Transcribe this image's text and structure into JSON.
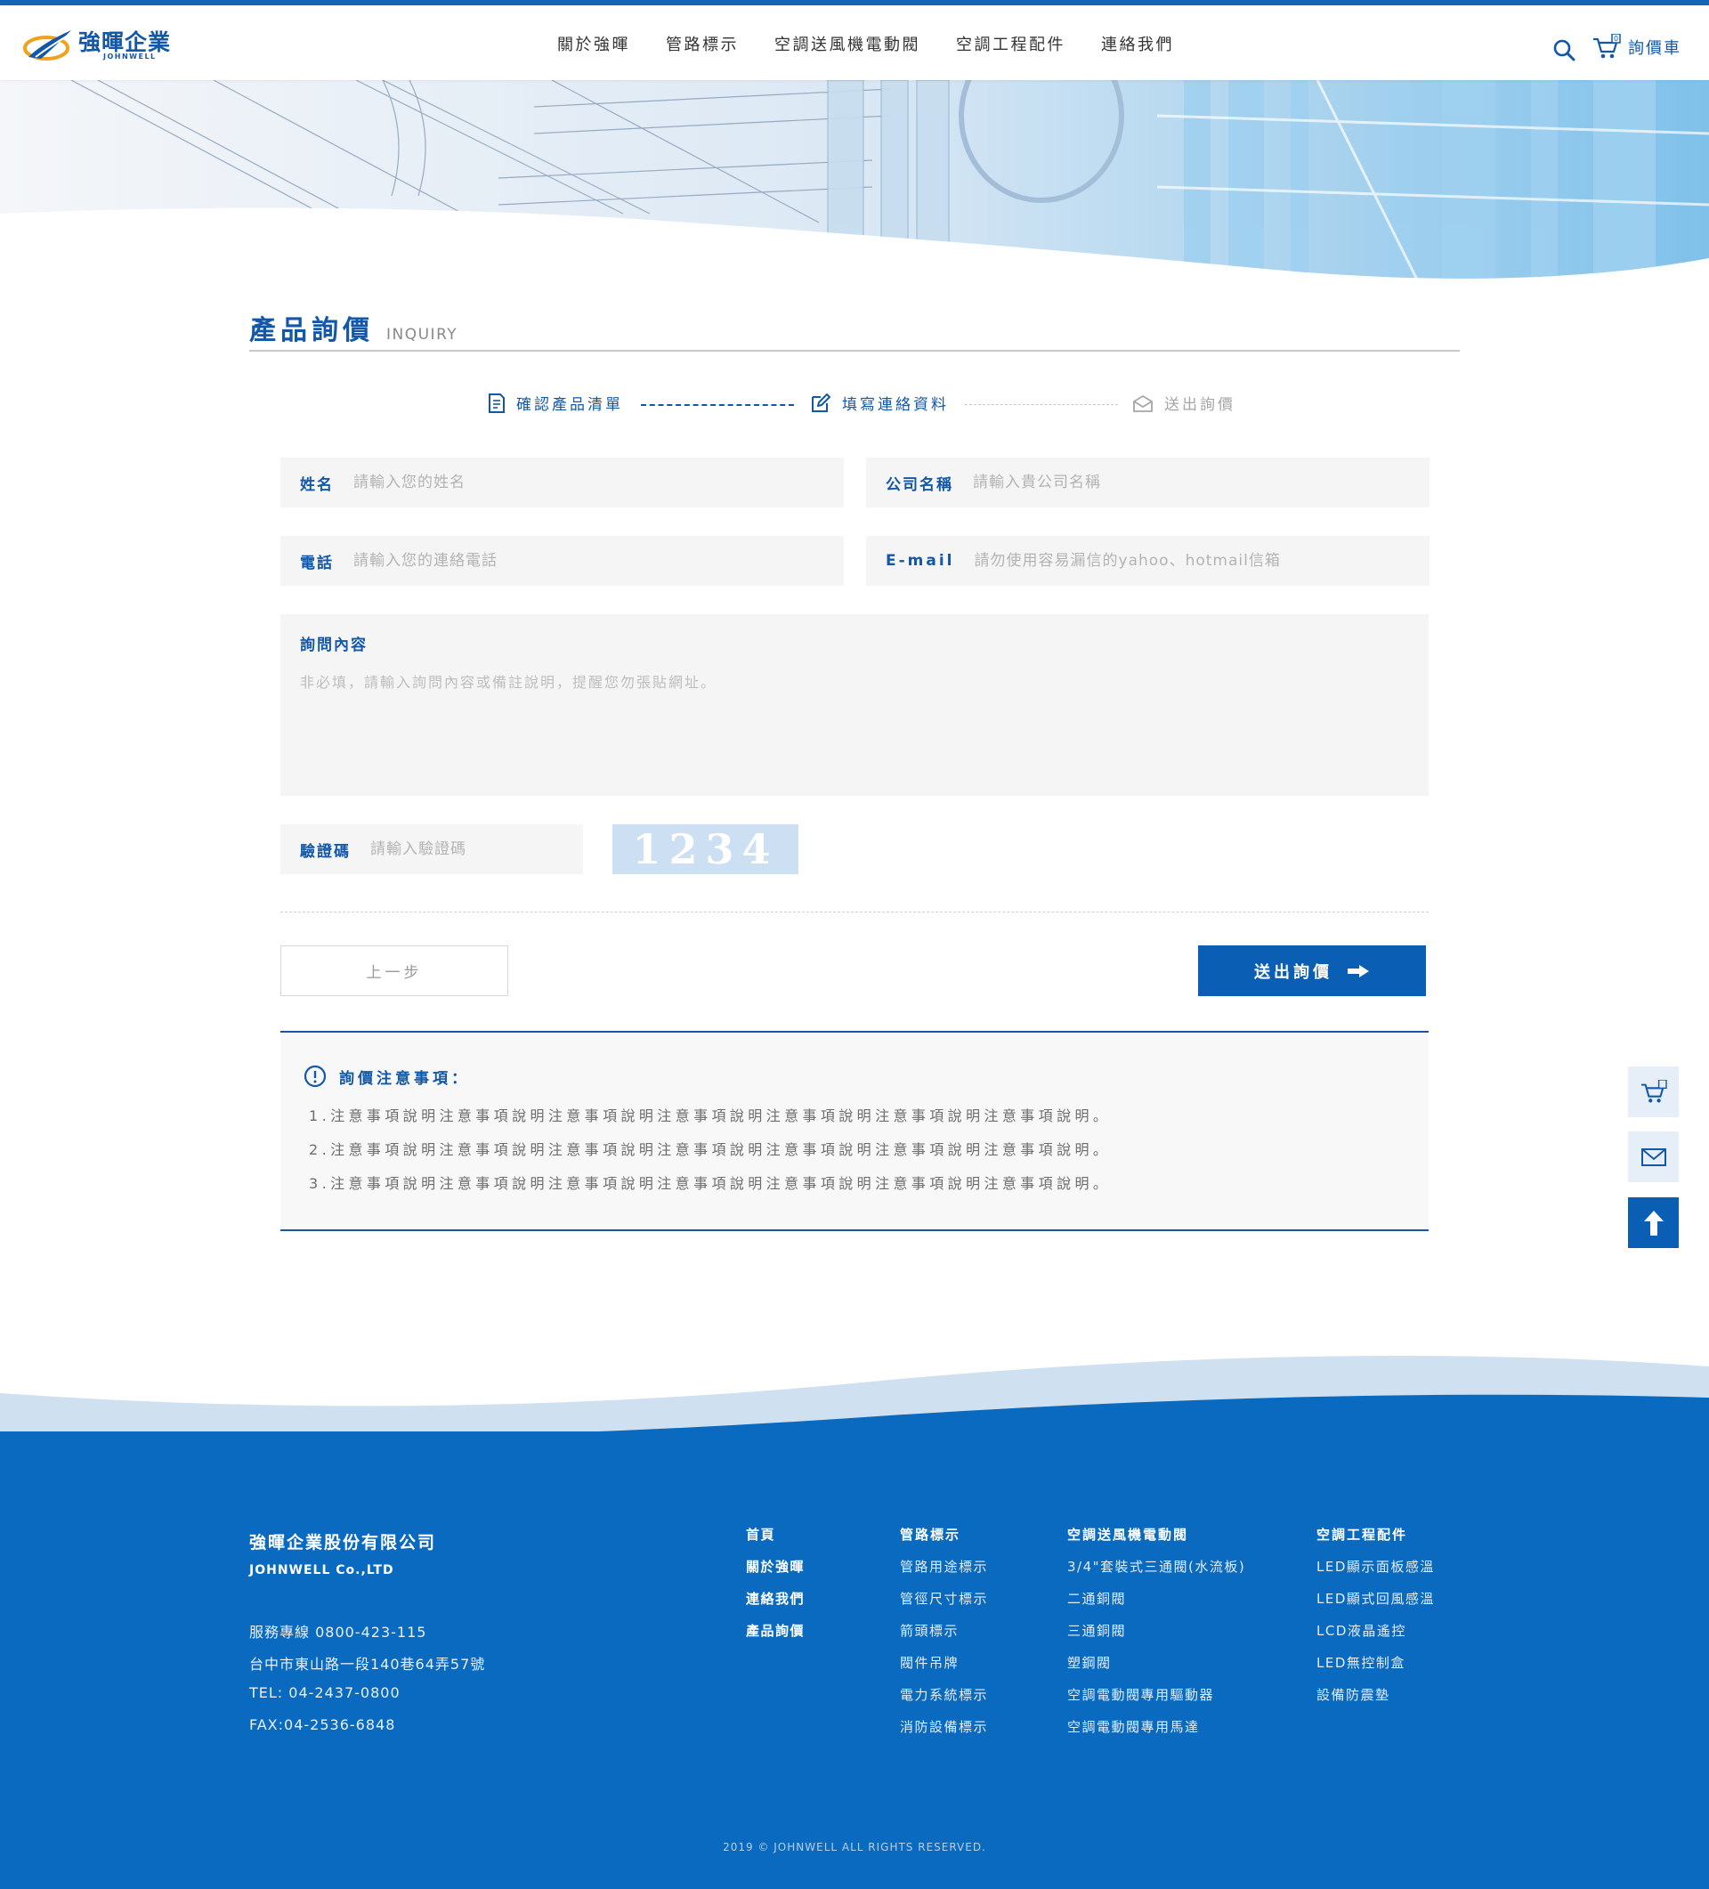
{
  "brand": {
    "name_zh": "強暉企業",
    "name_en": "JOHNWELL",
    "primary_color": "#1358a8",
    "button_color": "#0a5fb4",
    "footer_color": "#0a6ac0"
  },
  "nav": {
    "items": [
      "關於強暉",
      "管路標示",
      "空調送風機電動閥",
      "空調工程配件",
      "連絡我們"
    ],
    "search_icon": "search-icon",
    "cart_label": "詢價車",
    "cart_count": "0"
  },
  "page": {
    "title_zh": "產品詢價",
    "title_en": "INQUIRY"
  },
  "steps": [
    {
      "label": "確認產品清單",
      "state": "done",
      "icon": "list-icon"
    },
    {
      "label": "填寫連絡資料",
      "state": "active",
      "icon": "edit-icon"
    },
    {
      "label": "送出詢價",
      "state": "pending",
      "icon": "envelope-icon"
    }
  ],
  "form": {
    "name": {
      "label": "姓名",
      "placeholder": "請輸入您的姓名",
      "value": ""
    },
    "company": {
      "label": "公司名稱",
      "placeholder": "請輸入貴公司名稱",
      "value": ""
    },
    "phone": {
      "label": "電話",
      "placeholder": "請輸入您的連絡電話",
      "value": ""
    },
    "email": {
      "label": "E-mail",
      "placeholder": "請勿使用容易漏信的yahoo、hotmail信箱",
      "value": ""
    },
    "message": {
      "label": "詢問內容",
      "placeholder": "非必填，請輸入詢問內容或備註說明，提醒您勿張貼網址。",
      "value": ""
    },
    "captcha": {
      "label": "驗證碼",
      "placeholder": "請輸入驗證碼",
      "value": "",
      "code": "1234"
    },
    "prev_label": "上一步",
    "submit_label": "送出詢價"
  },
  "notice": {
    "title": "詢價注意事項：",
    "lines": [
      "1.注意事項說明注意事項說明注意事項說明注意事項說明注意事項說明注意事項說明注意事項說明。",
      "2.注意事項說明注意事項說明注意事項說明注意事項說明注意事項說明注意事項說明注意事項說明。",
      "3.注意事項說明注意事項說明注意事項說明注意事項說明注意事項說明注意事項說明注意事項說明。"
    ]
  },
  "side_buttons": [
    "cart-icon",
    "mail-icon",
    "arrow-up-icon"
  ],
  "footer": {
    "company_zh": "強暉企業股份有限公司",
    "company_en": "JOHNWELL Co.,LTD",
    "info": [
      "服務專線 0800-423-115",
      "台中市東山路一段140巷64弄57號",
      "TEL: 04-2437-0800",
      "FAX:04-2536-6848"
    ],
    "quick_links": [
      "首頁",
      "關於強暉",
      "連絡我們",
      "產品詢價"
    ],
    "col2": {
      "title": "管路標示",
      "links": [
        "管路用途標示",
        "管徑尺寸標示",
        "箭頭標示",
        "閥件吊牌",
        "電力系統標示",
        "消防設備標示"
      ]
    },
    "col3": {
      "title": "空調送風機電動閥",
      "links": [
        "3/4\"套裝式三通閥(水流板)",
        "二通銅閥",
        "三通銅閥",
        "塑鋼閥",
        "空調電動閥專用驅動器",
        "空調電動閥專用馬達"
      ]
    },
    "col4": {
      "title": "空調工程配件",
      "links": [
        "LED顯示面板感溫",
        "LED顯式回風感溫",
        "LCD液晶遙控",
        "LED無控制盒",
        "設備防震墊"
      ]
    },
    "copyright": "2019 © JOHNWELL ALL RIGHTS RESERVED."
  }
}
